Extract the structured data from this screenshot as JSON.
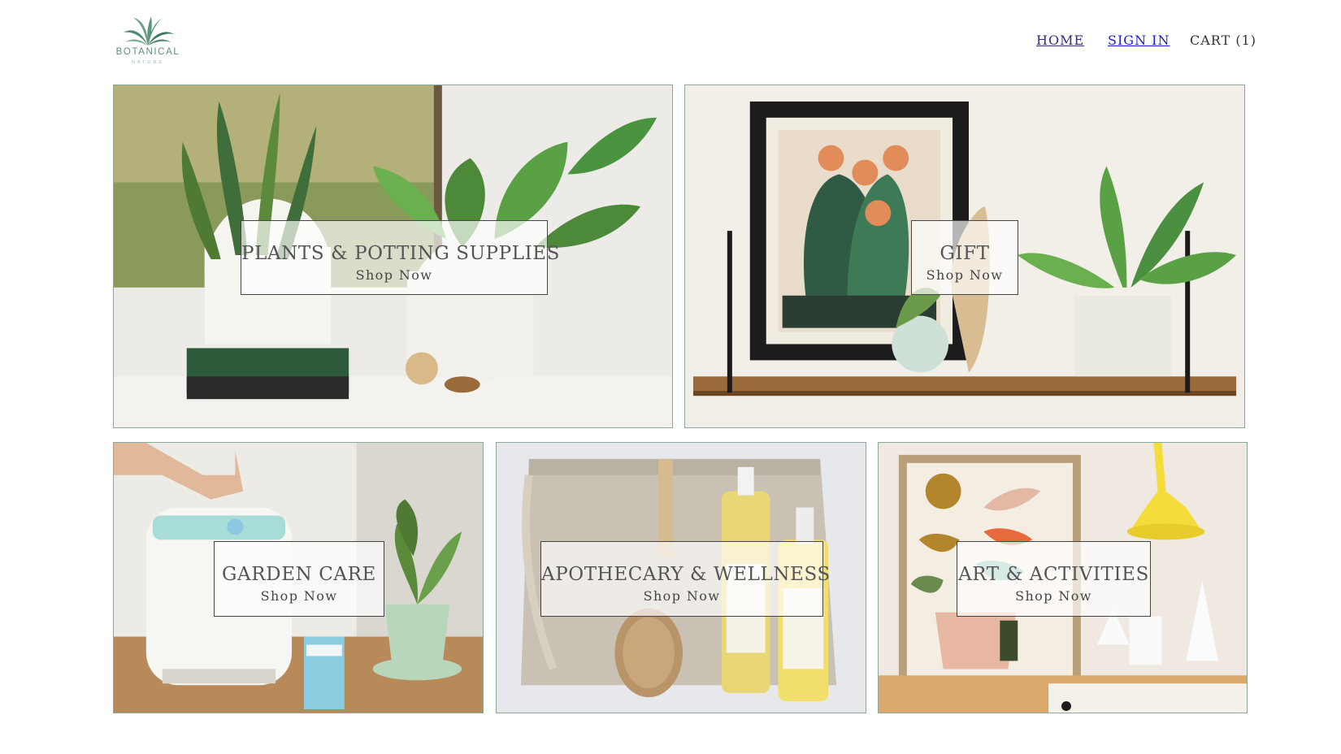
{
  "brand": {
    "name": "BOTANICAL",
    "tagline": "NATURE",
    "logo_icon": "leaf-bouquet-icon",
    "accent_color": "#5f8f7d"
  },
  "nav": {
    "home": "HOME",
    "sign_in": "SIGN IN",
    "cart": "CART (1)"
  },
  "categories": [
    {
      "title": "PLANTS & POTTING SUPPLIES",
      "cta": "Shop Now"
    },
    {
      "title": "GIFT",
      "cta": "Shop Now"
    },
    {
      "title": "GARDEN CARE",
      "cta": "Shop Now"
    },
    {
      "title": "APOTHECARY & WELLNESS",
      "cta": "Shop Now"
    },
    {
      "title": "ART & ACTIVITIES",
      "cta": "Shop Now"
    }
  ],
  "colors": {
    "tile_border": "#8fa89c",
    "link": "#1a1fd6",
    "visited_link": "#3b2a82"
  }
}
